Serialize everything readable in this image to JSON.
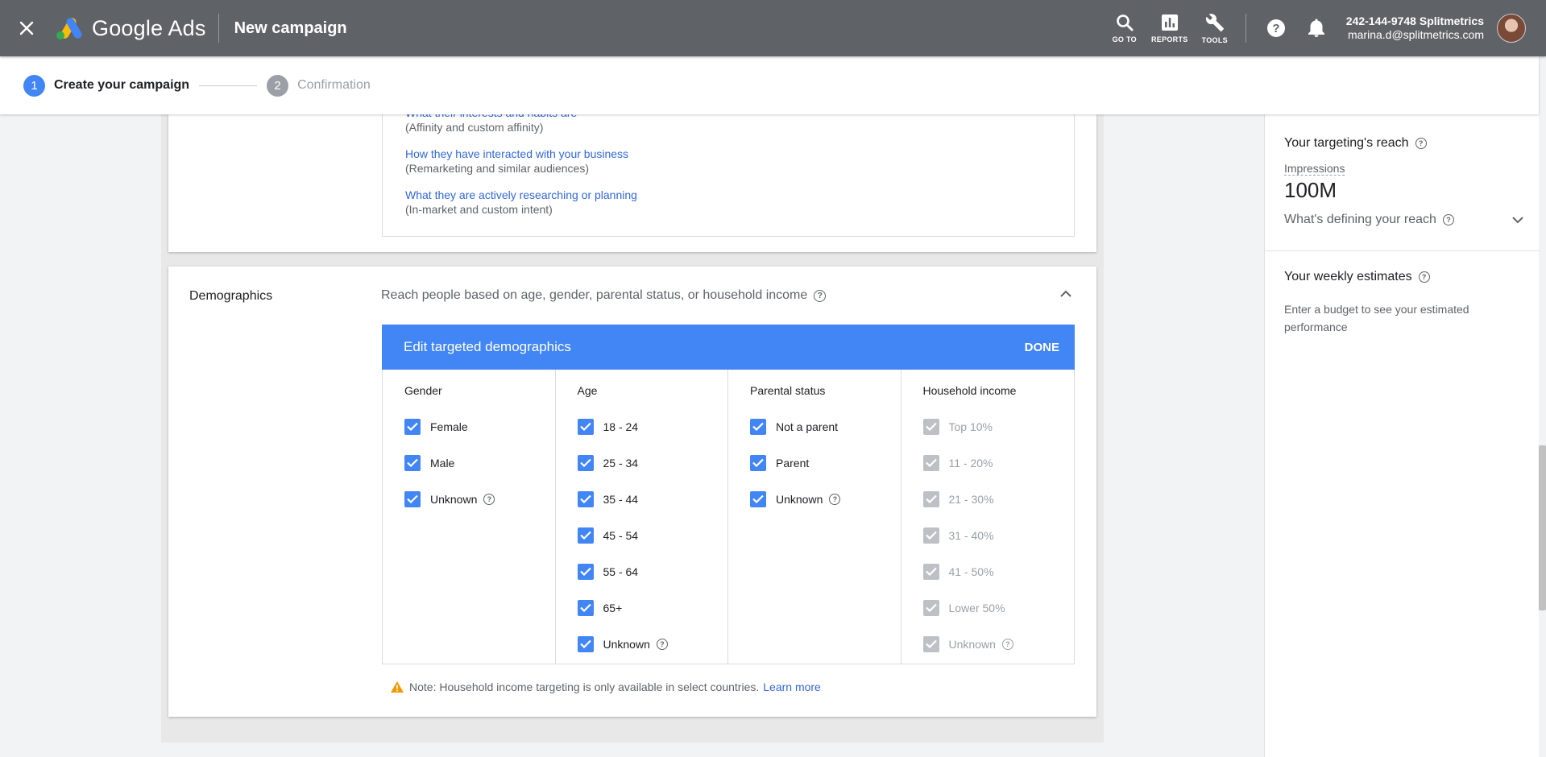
{
  "appbar": {
    "brand": "Google Ads",
    "title": "New campaign",
    "tools": [
      {
        "label": "GO TO",
        "icon": "search-icon"
      },
      {
        "label": "REPORTS",
        "icon": "reports-icon"
      },
      {
        "label": "TOOLS",
        "icon": "wrench-icon"
      }
    ],
    "account_phone": "242-144-9748 Splitmetrics",
    "account_email": "marina.d@splitmetrics.com"
  },
  "stepper": {
    "steps": [
      {
        "num": "1",
        "label": "Create your campaign",
        "state": "active"
      },
      {
        "num": "2",
        "label": "Confirmation",
        "state": "inactive"
      }
    ]
  },
  "audience": {
    "items": [
      {
        "link": "What their interests and habits are",
        "sub": "(Affinity and custom affinity)"
      },
      {
        "link": "How they have interacted with your business",
        "sub": "(Remarketing and similar audiences)"
      },
      {
        "link": "What they are actively researching or planning",
        "sub": "(In-market and custom intent)"
      }
    ]
  },
  "demographics": {
    "title": "Demographics",
    "description": "Reach people based on age, gender, parental status, or household income",
    "edit_title": "Edit targeted demographics",
    "done_label": "DONE",
    "columns": [
      {
        "heading": "Gender",
        "options": [
          {
            "label": "Female",
            "checked": true,
            "help": false
          },
          {
            "label": "Male",
            "checked": true,
            "help": false
          },
          {
            "label": "Unknown",
            "checked": true,
            "help": true
          }
        ]
      },
      {
        "heading": "Age",
        "options": [
          {
            "label": "18 - 24",
            "checked": true,
            "help": false
          },
          {
            "label": "25 - 34",
            "checked": true,
            "help": false
          },
          {
            "label": "35 - 44",
            "checked": true,
            "help": false
          },
          {
            "label": "45 - 54",
            "checked": true,
            "help": false
          },
          {
            "label": "55 - 64",
            "checked": true,
            "help": false
          },
          {
            "label": "65+",
            "checked": true,
            "help": false
          },
          {
            "label": "Unknown",
            "checked": true,
            "help": true
          }
        ]
      },
      {
        "heading": "Parental status",
        "options": [
          {
            "label": "Not a parent",
            "checked": true,
            "help": false
          },
          {
            "label": "Parent",
            "checked": true,
            "help": false
          },
          {
            "label": "Unknown",
            "checked": true,
            "help": true
          }
        ]
      },
      {
        "heading": "Household income",
        "disabled": true,
        "options": [
          {
            "label": "Top 10%",
            "checked": true,
            "help": false
          },
          {
            "label": "11 - 20%",
            "checked": true,
            "help": false
          },
          {
            "label": "21 - 30%",
            "checked": true,
            "help": false
          },
          {
            "label": "31 - 40%",
            "checked": true,
            "help": false
          },
          {
            "label": "41 - 50%",
            "checked": true,
            "help": false
          },
          {
            "label": "Lower 50%",
            "checked": true,
            "help": false
          },
          {
            "label": "Unknown",
            "checked": true,
            "help": true
          }
        ]
      }
    ],
    "note": "Note: Household income targeting is only available in select countries.",
    "learn_more": "Learn more"
  },
  "panel": {
    "reach_title": "Your targeting's reach",
    "impressions_label": "Impressions",
    "impressions_value": "100M",
    "defining_label": "What's defining your reach",
    "weekly_title": "Your weekly estimates",
    "weekly_text": "Enter a budget to see your estimated performance"
  },
  "colors": {
    "appbar": "#5f6368",
    "accent": "#4285f4",
    "link": "#3367d6",
    "warning": "#f29900"
  }
}
